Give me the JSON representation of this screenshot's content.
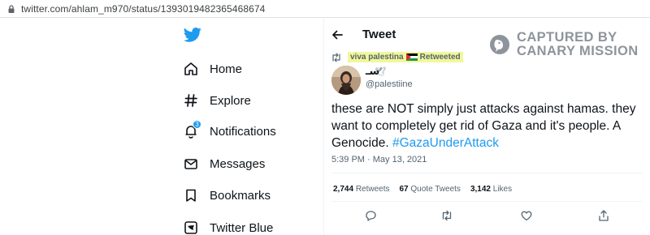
{
  "browser": {
    "url": "twitter.com/ahlam_m970/status/1393019482365468674"
  },
  "sidebar": {
    "items": [
      {
        "label": "Home",
        "icon": "home-icon"
      },
      {
        "label": "Explore",
        "icon": "hashtag-icon"
      },
      {
        "label": "Notifications",
        "icon": "bell-icon",
        "badge": "3"
      },
      {
        "label": "Messages",
        "icon": "envelope-icon"
      },
      {
        "label": "Bookmarks",
        "icon": "bookmark-icon"
      },
      {
        "label": "Twitter Blue",
        "icon": "twitter-blue-icon"
      }
    ]
  },
  "header": {
    "title": "Tweet"
  },
  "watermark": {
    "line1": "CAPTURED BY",
    "line2": "CANARY MISSION"
  },
  "tweet": {
    "retweeted_by": "viva palestina",
    "retweeted_suffix": "Retweeted",
    "author_name": "ﺳـ",
    "author_symbol": "🕊",
    "handle": "@palestiine",
    "text_main": "these are NOT simply just attacks against hamas. they want to completely get rid of Gaza and it's people. A Genocide.",
    "hashtag": "#GazaUnderAttack",
    "timestamp": "5:39 PM · May 13, 2021",
    "retweets_count": "2,744",
    "retweets_label": "Retweets",
    "quotes_count": "67",
    "quotes_label": "Quote Tweets",
    "likes_count": "3,142",
    "likes_label": "Likes"
  },
  "colors": {
    "twitter_blue": "#1d9bf0",
    "highlight": "#f2f79a",
    "watermark": "#8e949c"
  }
}
